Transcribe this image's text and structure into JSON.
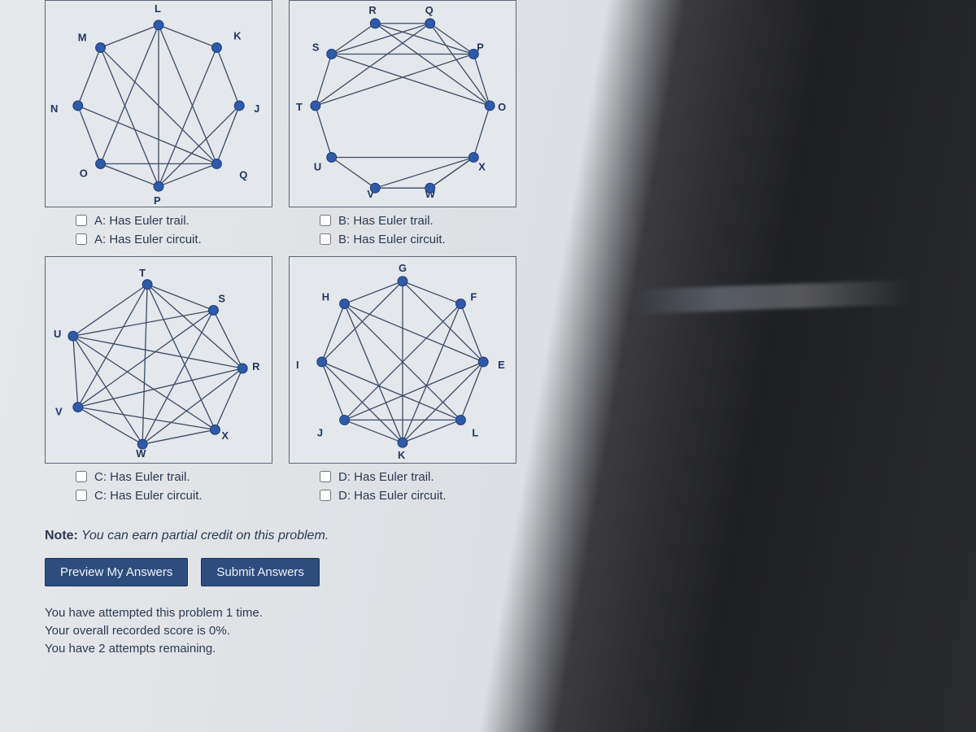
{
  "graphs": {
    "A": {
      "nodes": [
        "L",
        "K",
        "J",
        "Q",
        "P",
        "O",
        "N",
        "M"
      ],
      "checks": [
        {
          "label": "A: Has Euler trail."
        },
        {
          "label": "A: Has Euler circuit."
        }
      ]
    },
    "B": {
      "nodes": [
        "R",
        "Q",
        "P",
        "O",
        "X",
        "W",
        "V",
        "U",
        "T",
        "S"
      ],
      "checks": [
        {
          "label": "B: Has Euler trail."
        },
        {
          "label": "B: Has Euler circuit."
        }
      ]
    },
    "C": {
      "nodes": [
        "T",
        "S",
        "R",
        "X",
        "W",
        "V",
        "U"
      ],
      "checks": [
        {
          "label": "C: Has Euler trail."
        },
        {
          "label": "C: Has Euler circuit."
        }
      ]
    },
    "D": {
      "nodes": [
        "G",
        "F",
        "E",
        "L",
        "K",
        "J",
        "I",
        "H"
      ],
      "checks": [
        {
          "label": "D: Has Euler trail."
        },
        {
          "label": "D: Has Euler circuit."
        }
      ]
    }
  },
  "note_bold": "Note:",
  "note_rest": " You can earn partial credit on this problem.",
  "buttons": {
    "preview": "Preview My Answers",
    "submit": "Submit Answers"
  },
  "status": {
    "line1": "You have attempted this problem 1 time.",
    "line2": "Your overall recorded score is 0%.",
    "line3": "You have 2 attempts remaining."
  }
}
